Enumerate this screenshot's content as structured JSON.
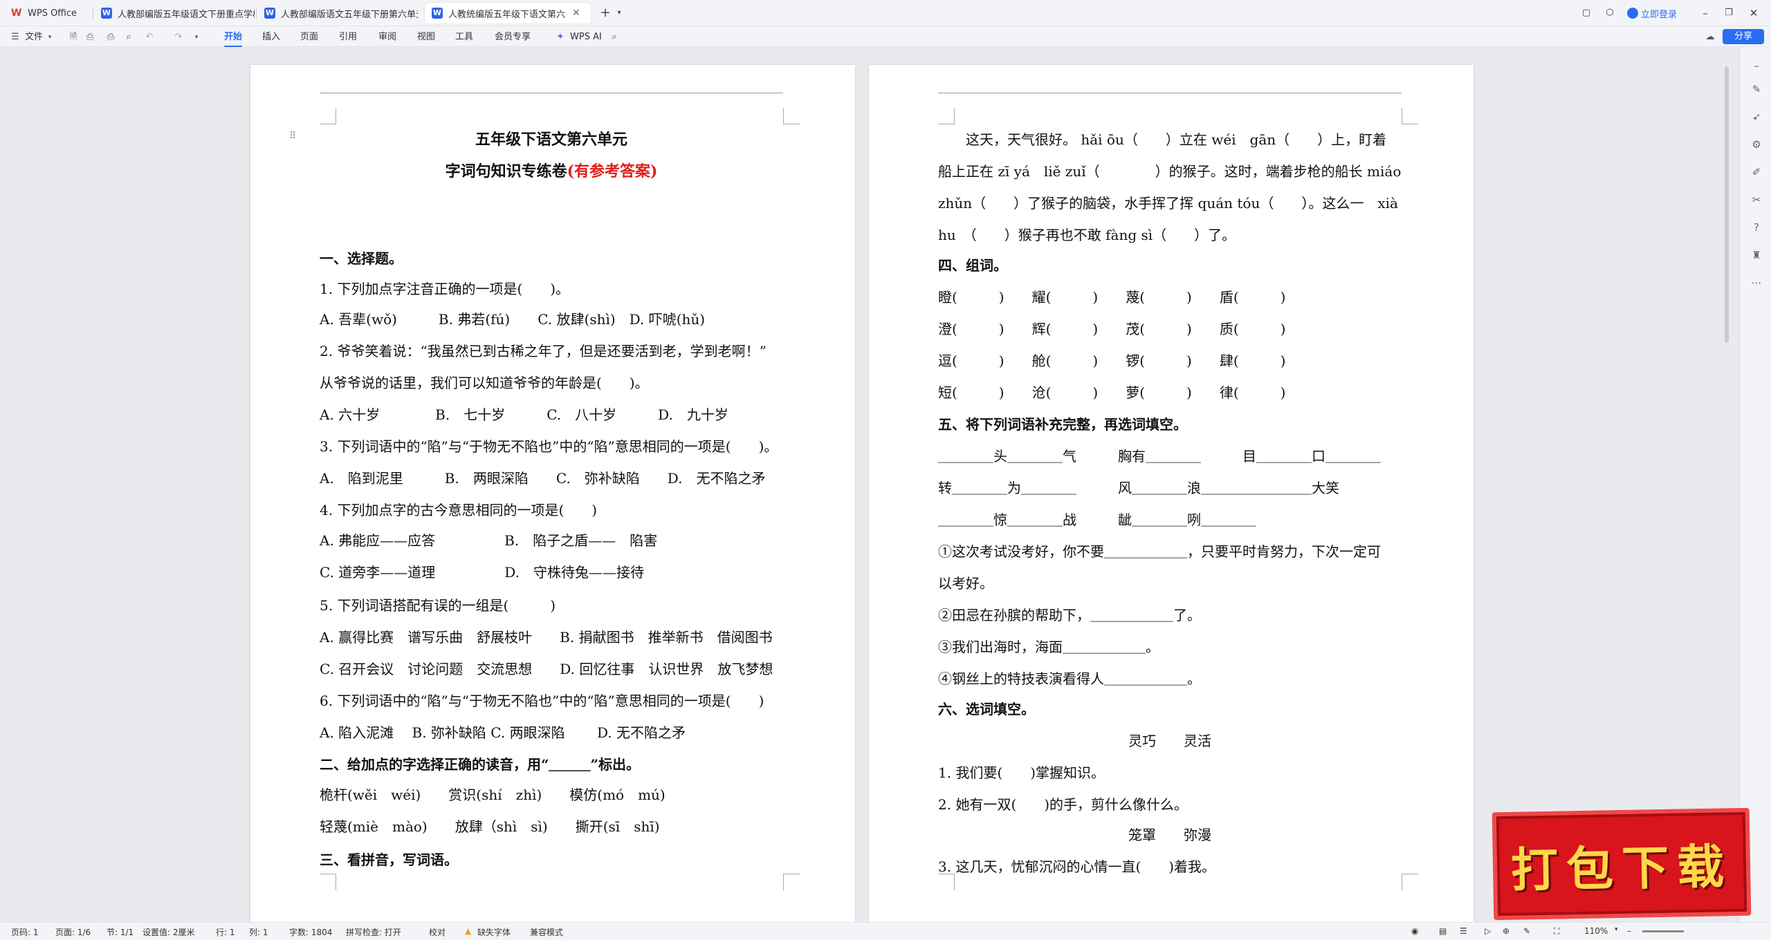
{
  "tabs": {
    "wps": "WPS Office",
    "tab1": "人教部编版五年级语文下册重点学校",
    "tab2": "人教部编版语文五年级下册第六单元",
    "tab3": "人教统编版五年级下语文第六"
  },
  "titlebar": {
    "login": "立即登录"
  },
  "menu": {
    "file": "文件",
    "items": [
      "开始",
      "插入",
      "页面",
      "引用",
      "审阅",
      "视图",
      "工具",
      "会员专享"
    ],
    "wps_ai": "WPS AI",
    "share": "分享"
  },
  "page1": {
    "title": "五年级下语文第六单元",
    "subtitle": "字词句知识专练卷",
    "subtitle_red": "(有参考答案)",
    "lines": [
      "一、选择题。",
      "1. 下列加点字注音正确的一项是(　　)。",
      "A. 吾辈(wǒ)　　　B. 弗若(fú)　　C. 放肆(shì)　D. 吓唬(hǔ)",
      "2. 爷爷笑着说：“我虽然已到古稀之年了，但是还要活到老，学到老啊！”",
      "从爷爷说的话里，我们可以知道爷爷的年龄是(　　)。",
      "A. 六十岁　　　　B.　七十岁　　　C.　八十岁　　　D.　九十岁",
      "3. 下列词语中的“陷”与“于物无不陷也”中的“陷”意思相同的一项是(　　)。",
      "A.　陷到泥里　　　B.　两眼深陷　　C.　弥补缺陷　　D.　无不陷之矛",
      "4. 下列加点字的古今意思相同的一项是(　　)",
      "A. 弗能应——应答　　　　　B.　陷子之盾——　陷害",
      "C. 道旁李——道理　　　　　D.　守株待兔——接待",
      "5. 下列词语搭配有误的一组是(　　　)",
      "A. 赢得比赛　谱写乐曲　舒展枝叶　　B. 捐献图书　推举新书　借阅图书",
      "C. 召开会议　讨论问题　交流思想　　D. 回忆往事　认识世界　放飞梦想",
      "6. 下列词语中的“陷”与“于物无不陷也”中的“陷”意思相同的一项是(　　)",
      "A. 陷入泥滩　 B. 弥补缺陷 C. 两眼深陷　　 D. 无不陷之矛",
      "二、给加点的字选择正确的读音，用“＿＿＿”标出。",
      "桅杆(wěi　wéi)　　赏识(shí　zhì)　　模仿(mó　mú)",
      "轻蔑(miè　mào)　　放肆（shì　sì)　　撕开(sī　shī)",
      "三、看拼音，写词语。"
    ]
  },
  "page2": {
    "lines": [
      "　　这天，天气很好。 hǎi ōu（　　）立在 wéi　gān（　　）上，盯着",
      "船上正在 zī yá　liě zuǐ（　　　　）的猴子。这时，端着步枪的船长 miáo",
      "zhǔn（　　）了猴子的脑袋，水手挥了挥 quán tóu（　　）。这么一　xià",
      "hu　（　　）猴子再也不敢 fàng sì（　　）了。",
      "四、组词。",
      "瞪(　　　)　　耀(　　　)　　蔑(　　　)　　盾(　　　)",
      "澄(　　　)　　辉(　　　)　　茂(　　　)　　质(　　　)",
      "逗(　　　)　　舱(　　　)　　锣(　　　)　　肆(　　　)",
      "短(　　　)　　沧(　　　)　　萝(　　　)　　律(　　　)",
      "五、将下列词语补充完整，再选词填空。",
      "＿＿＿＿头＿＿＿＿气　　　胸有＿＿＿＿　　　目＿＿＿＿口＿＿＿＿",
      "转＿＿＿＿为＿＿＿＿　　　风＿＿＿＿浪＿＿＿＿＿＿＿＿大笑",
      "＿＿＿＿惊＿＿＿＿战　　　龇＿＿＿＿咧＿＿＿＿",
      "①这次考试没考好，你不要＿＿＿＿＿＿，只要平时肯努力，下次一定可",
      "以考好。",
      "②田忌在孙膑的帮助下，＿＿＿＿＿＿了。",
      "③我们出海时，海面＿＿＿＿＿＿。",
      "④钢丝上的特技表演看得人＿＿＿＿＿＿。",
      "六、选词填空。",
      "灵巧　　灵活",
      "1. 我们要(　　)掌握知识。",
      "2. 她有一双(　　)的手，剪什么像什么。",
      "笼罩　　弥漫",
      "3. 这几天，忧郁沉闷的心情一直(　　)着我。"
    ]
  },
  "statusbar": {
    "page_num": "页码: 1",
    "pages": "页面: 1/6",
    "section": "节: 1/1",
    "setting": "设置值: 2厘米",
    "row": "行: 1",
    "col": "列: 1",
    "words": "字数: 1804",
    "spell": "拼写检查: 打开",
    "proof": "校对",
    "font_missing": "缺失字体",
    "compat": "兼容模式",
    "zoom": "110%"
  },
  "banner": {
    "text": "打包下载"
  },
  "colors": {
    "accent": "#2b6cf5",
    "red": "#e0201c",
    "banner": "#d8141c"
  }
}
